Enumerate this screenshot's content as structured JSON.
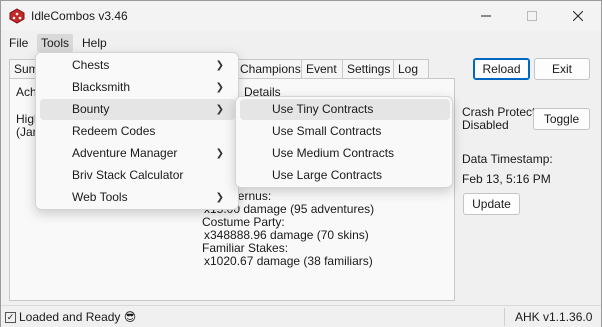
{
  "window": {
    "title": "IdleCombos v3.46"
  },
  "menubar": [
    "File",
    "Tools",
    "Help"
  ],
  "tabs": [
    "Sum",
    "Champions",
    "Event",
    "Settings",
    "Log"
  ],
  "panel": {
    "ach_fragment": "Ach",
    "high_fragment": "High",
    "jan_fragment": "(Jan",
    "details_label": "Details",
    "lines": [
      "s of Avernus:",
      "x15.00 damage (95 adventures)",
      "Costume Party:",
      "x348888.96 damage (70 skins)",
      "Familiar Stakes:",
      "x1020.67 damage (38 familiars)"
    ]
  },
  "side": {
    "reload": "Reload",
    "exit": "Exit",
    "crash_protect": "Crash Protect",
    "crash_status": "Disabled",
    "toggle": "Toggle",
    "data_timestamp_label": "Data Timestamp:",
    "data_timestamp_value": "Feb 13, 5:16 PM",
    "update": "Update"
  },
  "tools_menu": [
    {
      "label": "Chests",
      "submenu": true
    },
    {
      "label": "Blacksmith",
      "submenu": true
    },
    {
      "label": "Bounty",
      "submenu": true
    },
    {
      "label": "Redeem Codes",
      "submenu": false
    },
    {
      "label": "Adventure Manager",
      "submenu": true
    },
    {
      "label": "Briv Stack Calculator",
      "submenu": false
    },
    {
      "label": "Web Tools",
      "submenu": true
    }
  ],
  "bounty_submenu": [
    "Use Tiny Contracts",
    "Use Small Contracts",
    "Use Medium Contracts",
    "Use Large Contracts"
  ],
  "status": {
    "text": "Loaded and Ready 😎",
    "version": "AHK v1.1.36.0"
  },
  "icons": {
    "app": "red-dice-icon",
    "arrow": "chevron-right-icon",
    "minimize": "minimize-icon",
    "maximize": "maximize-icon",
    "close": "close-icon"
  },
  "colors": {
    "accent": "#0067c0",
    "app_icon": "#c62828"
  }
}
